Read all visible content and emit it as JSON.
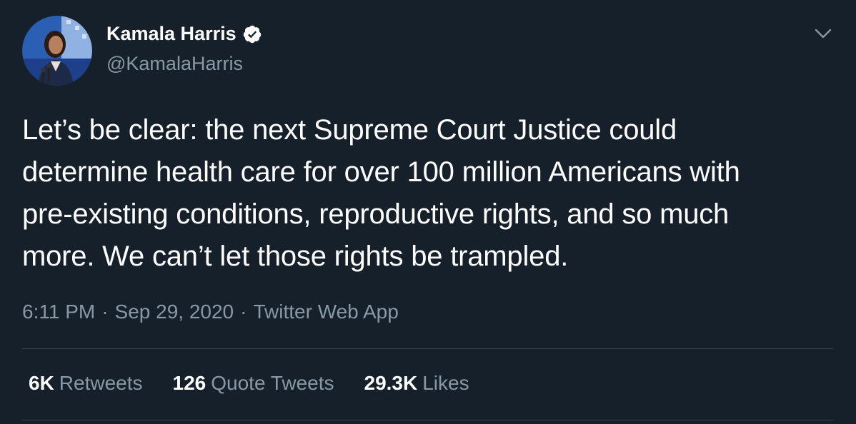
{
  "author": {
    "name": "Kamala Harris",
    "handle": "@KamalaHarris",
    "verified": true,
    "avatar_icon": "avatar-photo"
  },
  "tweet": {
    "text": "Let’s be clear: the next Supreme Court Justice could\ndetermine health care for over 100 million Americans with\npre-existing conditions, reproductive rights, and so much\nmore. We can’t let those rights be trampled.",
    "time": "6:11 PM",
    "date": "Sep 29, 2020",
    "source": "Twitter Web App",
    "separator": "·"
  },
  "stats": [
    {
      "value": "6K",
      "label": "Retweets"
    },
    {
      "value": "126",
      "label": "Quote Tweets"
    },
    {
      "value": "29.3K",
      "label": "Likes"
    }
  ],
  "menu": {
    "icon": "chevron-down-icon"
  },
  "colors": {
    "background": "#15202b",
    "primary_text": "#ffffff",
    "secondary_text": "#8899a6",
    "divider": "#38444d"
  }
}
